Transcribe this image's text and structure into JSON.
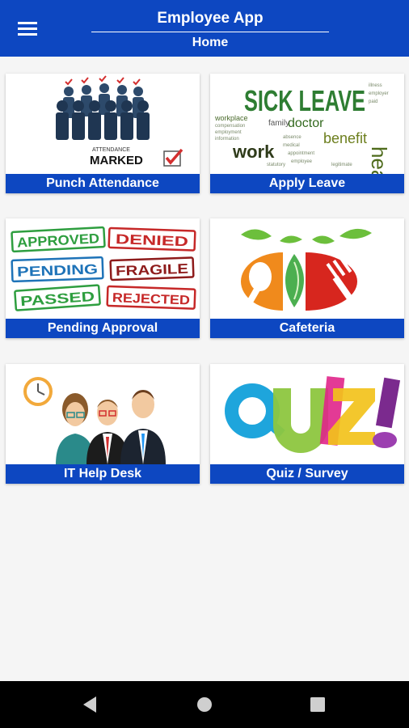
{
  "app_bar": {
    "title": "Employee App",
    "subtitle": "Home",
    "menu_icon": "hamburger-menu-icon"
  },
  "tiles": [
    {
      "label": "Punch Attendance",
      "image": "attendance-marked-illustration",
      "image_text": [
        "ATTENDANCE",
        "MARKED"
      ]
    },
    {
      "label": "Apply Leave",
      "image": "sick-leave-word-cloud",
      "image_text": [
        "SICK LEAVE",
        "doctor",
        "benefit",
        "work",
        "health",
        "family",
        "workplace"
      ]
    },
    {
      "label": "Pending Approval",
      "image": "status-stamps-illustration",
      "image_text": [
        "APPROVED",
        "DENIED",
        "PENDING",
        "FRAGILE",
        "PASSED",
        "REJECTED"
      ]
    },
    {
      "label": "Cafeteria",
      "image": "cafeteria-spoon-fork-logo"
    },
    {
      "label": "IT Help Desk",
      "image": "helpdesk-people-clock-illustration"
    },
    {
      "label": "Quiz / Survey",
      "image": "quiz-colorful-lettering",
      "image_text": [
        "QUIZ!"
      ]
    }
  ],
  "system_nav": {
    "back_icon": "back-triangle-icon",
    "home_icon": "home-circle-icon",
    "recents_icon": "recents-square-icon"
  },
  "colors": {
    "primary": "#0d47c1",
    "background": "#f5f5f5",
    "nav_bar": "#000000"
  }
}
